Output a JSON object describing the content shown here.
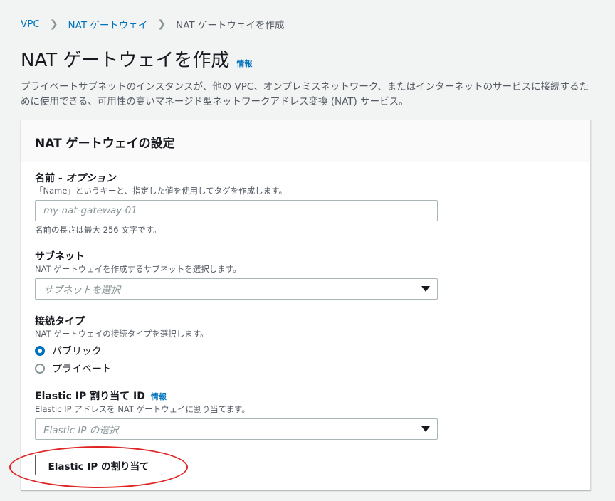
{
  "breadcrumb": {
    "items": [
      "VPC",
      "NAT ゲートウェイ"
    ],
    "current": "NAT ゲートウェイを作成"
  },
  "page": {
    "title": "NAT ゲートウェイを作成",
    "info": "情報",
    "description": "プライベートサブネットのインスタンスが、他の VPC、オンプレミスネットワーク、またはインターネットのサービスに接続するために使用できる、可用性の高いマネージド型ネットワークアドレス変換 (NAT) サービス。"
  },
  "panel": {
    "title": "NAT ゲートウェイの設定",
    "name_field": {
      "label": "名前 - ",
      "label_optional": "オプション",
      "description": "「Name」というキーと、指定した値を使用してタグを作成します。",
      "placeholder": "my-nat-gateway-01",
      "constraint": "名前の長さは最大 256 文字です。"
    },
    "subnet_field": {
      "label": "サブネット",
      "description": "NAT ゲートウェイを作成するサブネットを選択します。",
      "placeholder": "サブネットを選択"
    },
    "connectivity_field": {
      "label": "接続タイプ",
      "description": "NAT ゲートウェイの接続タイプを選択します。",
      "options": [
        "パブリック",
        "プライベート"
      ],
      "selected": "パブリック"
    },
    "eip_field": {
      "label": "Elastic IP 割り当て ID",
      "info": "情報",
      "description": "Elastic IP アドレスを NAT ゲートウェイに割り当てます。",
      "placeholder": "Elastic IP の選択"
    },
    "allocate_button": "Elastic IP の割り当て"
  },
  "colors": {
    "link": "#0073bb",
    "annotation": "#e02424"
  }
}
